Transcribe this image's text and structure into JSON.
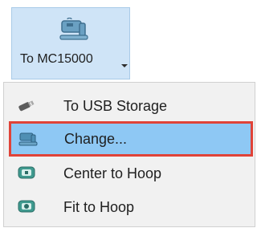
{
  "toolbar": {
    "button_label": "To MC15000",
    "button_icon": "sewing-machine-icon"
  },
  "menu": {
    "items": [
      {
        "label": "To USB Storage",
        "icon": "usb-drive-icon",
        "selected": false
      },
      {
        "label": "Change...",
        "icon": "sewing-machine-icon",
        "selected": true
      },
      {
        "label": "Center to Hoop",
        "icon": "hoop-center-icon",
        "selected": false
      },
      {
        "label": "Fit to Hoop",
        "icon": "hoop-fit-icon",
        "selected": false
      }
    ]
  },
  "colors": {
    "button_background": "#cfe4f7",
    "menu_background": "#f1f1f1",
    "selected_background": "#8ec8f4",
    "selected_outline": "#e04338"
  }
}
